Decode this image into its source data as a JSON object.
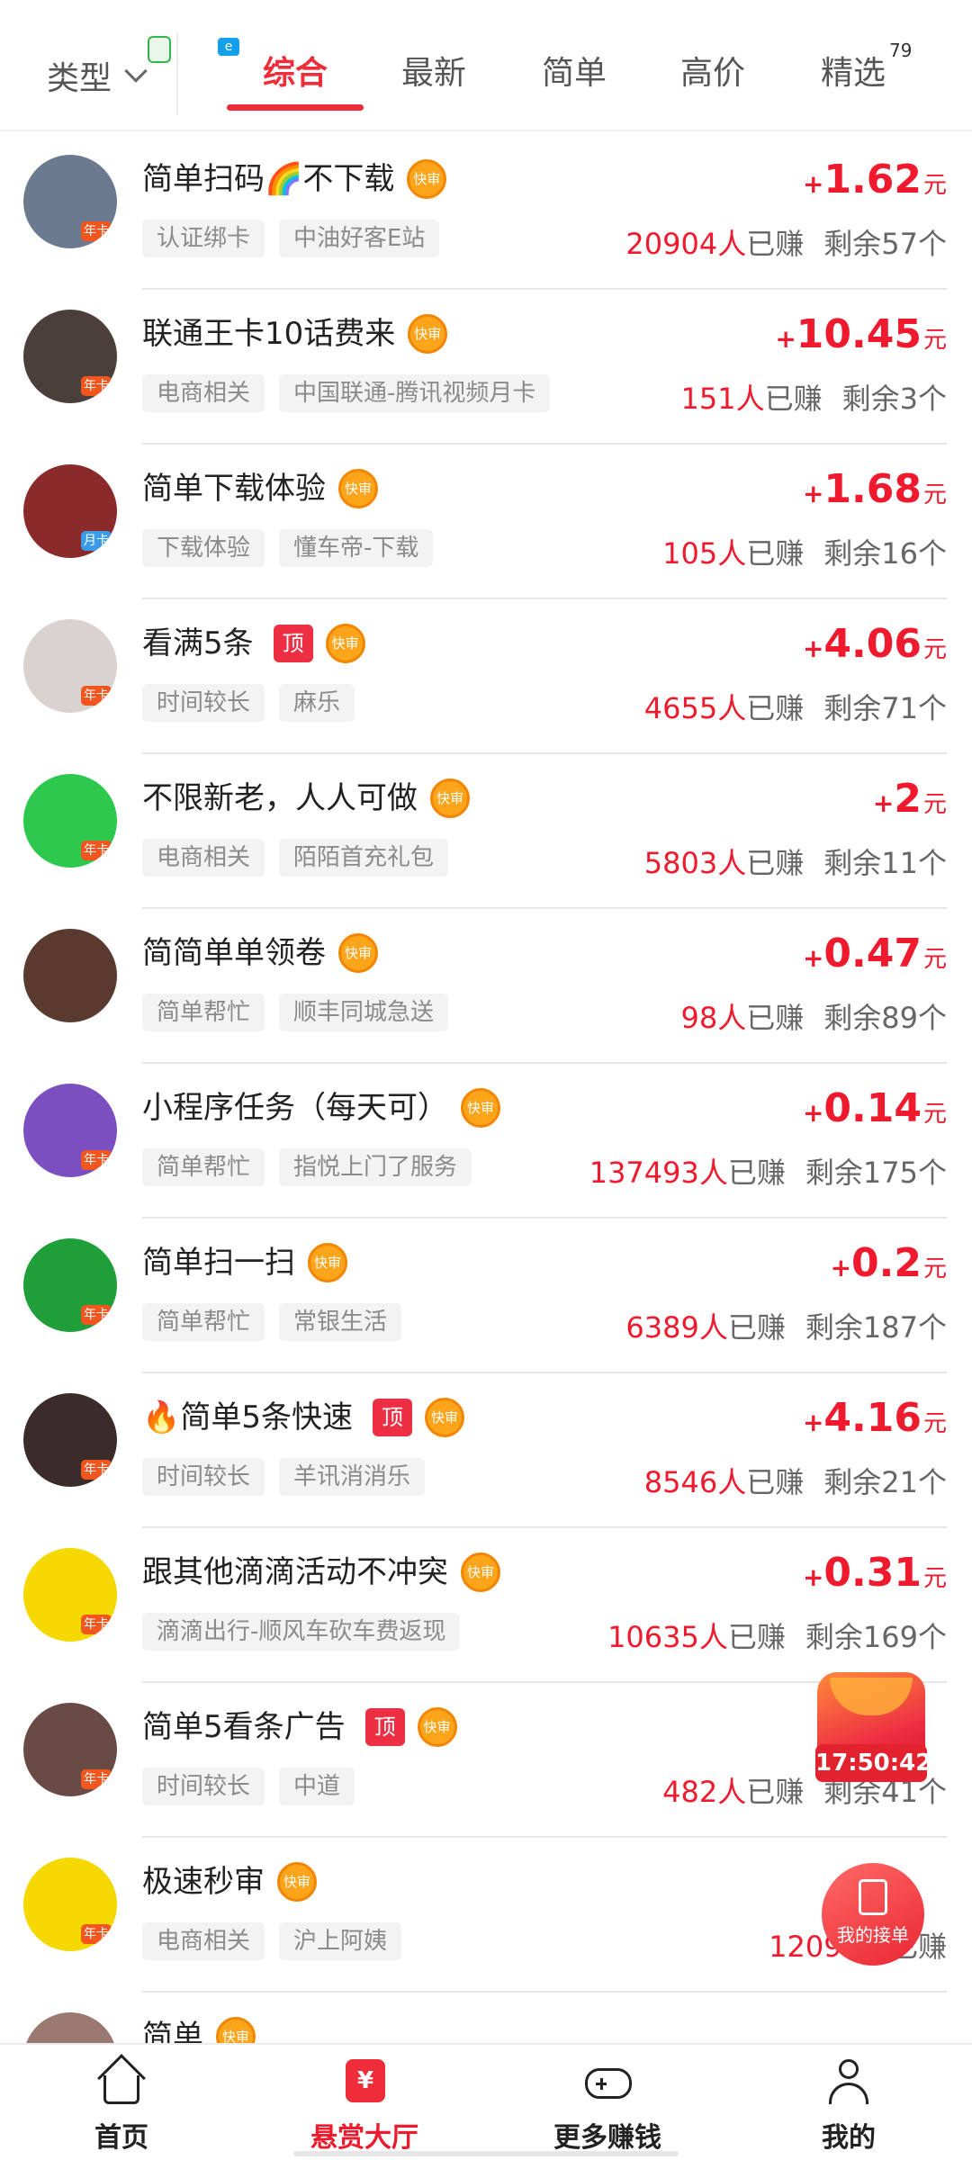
{
  "top_filter": {
    "label": "类型"
  },
  "tabs": [
    {
      "label": "综合",
      "active": true
    },
    {
      "label": "最新"
    },
    {
      "label": "简单"
    },
    {
      "label": "高价"
    },
    {
      "label": "精选",
      "badge": "79"
    }
  ],
  "tag_labels": {
    "top": "顶",
    "fast": "快审"
  },
  "stats_labels": {
    "earned_suffix": "已赚",
    "remaining_prefix": "剩余",
    "remaining_suffix": "个"
  },
  "price_labels": {
    "plus": "+",
    "unit": "元"
  },
  "tasks": [
    {
      "avatar_color": "#6b7a8f",
      "avatar_badge": "年卡",
      "title": "简单扫码🌈不下载",
      "top": false,
      "tags": [
        "认证绑卡",
        "中油好客E站"
      ],
      "reward": "1.62",
      "earned_count": "20904人",
      "remaining": "57"
    },
    {
      "avatar_color": "#4a3f3a",
      "avatar_badge": "年卡",
      "title": "联通王卡10话费来",
      "top": false,
      "tags": [
        "电商相关",
        "中国联通-腾讯视频月卡"
      ],
      "reward": "10.45",
      "earned_count": "151人",
      "remaining": "3"
    },
    {
      "avatar_color": "#8b2a2a",
      "avatar_badge": "月卡",
      "title": "简单下载体验",
      "top": false,
      "tags": [
        "下载体验",
        "懂车帝-下载"
      ],
      "reward": "1.68",
      "earned_count": "105人",
      "remaining": "16"
    },
    {
      "avatar_color": "#d9d2cf",
      "avatar_badge": "年卡",
      "title": "看满5条",
      "top": true,
      "tags": [
        "时间较长",
        "麻乐"
      ],
      "reward": "4.06",
      "earned_count": "4655人",
      "remaining": "71"
    },
    {
      "avatar_color": "#2dc84d",
      "avatar_badge": "年卡",
      "title": "不限新老，人人可做",
      "top": false,
      "tags": [
        "电商相关",
        "陌陌首充礼包"
      ],
      "reward": "2",
      "earned_count": "5803人",
      "remaining": "11"
    },
    {
      "avatar_color": "#5a3a2e",
      "avatar_badge": "",
      "title": "简简单单领卷",
      "top": false,
      "tags": [
        "简单帮忙",
        "顺丰同城急送"
      ],
      "reward": "0.47",
      "earned_count": "98人",
      "remaining": "89"
    },
    {
      "avatar_color": "#7b4fbf",
      "avatar_badge": "年卡",
      "title": "小程序任务（每天可）",
      "top": false,
      "tags": [
        "简单帮忙",
        "指悦上门了服务"
      ],
      "reward": "0.14",
      "earned_count": "137493人",
      "remaining": "175"
    },
    {
      "avatar_color": "#1f9e3a",
      "avatar_badge": "年卡",
      "title": "简单扫一扫",
      "top": false,
      "tags": [
        "简单帮忙",
        "常银生活"
      ],
      "reward": "0.2",
      "earned_count": "6389人",
      "remaining": "187"
    },
    {
      "avatar_color": "#3b2b2b",
      "avatar_badge": "年卡",
      "title": "🔥简单5条快速",
      "top": true,
      "tags": [
        "时间较长",
        "羊讯消消乐"
      ],
      "reward": "4.16",
      "earned_count": "8546人",
      "remaining": "21"
    },
    {
      "avatar_color": "#f5d800",
      "avatar_badge": "年卡",
      "title": "跟其他滴滴活动不冲突",
      "top": false,
      "tags": [
        "滴滴出行-顺风车砍车费返现"
      ],
      "reward": "0.31",
      "earned_count": "10635人",
      "remaining": "169"
    },
    {
      "avatar_color": "#6a4a45",
      "avatar_badge": "年卡",
      "title": "简单5看条广告",
      "top": true,
      "tags": [
        "时间较长",
        "中道"
      ],
      "reward": "",
      "earned_count": "482人",
      "remaining": "41"
    },
    {
      "avatar_color": "#f5d800",
      "avatar_badge": "年卡",
      "title": "极速秒审",
      "top": false,
      "tags": [
        "电商相关",
        "沪上阿姨"
      ],
      "reward": "",
      "earned_count": "12092人",
      "remaining": ""
    },
    {
      "avatar_color": "#9a7a70",
      "avatar_badge": "",
      "title": "简单",
      "top": false,
      "tags": [],
      "reward": "",
      "earned_count": "",
      "remaining": ""
    }
  ],
  "float_redpacket": {
    "timer": "17:50:42"
  },
  "float_orders": {
    "label": "我的接单"
  },
  "bottom_nav": [
    {
      "label": "首页",
      "icon": "home-icon"
    },
    {
      "label": "悬赏大厅",
      "icon": "hall-icon",
      "active": true,
      "glyph": "¥"
    },
    {
      "label": "更多赚钱",
      "icon": "gamepad-icon"
    },
    {
      "label": "我的",
      "icon": "user-icon"
    }
  ]
}
